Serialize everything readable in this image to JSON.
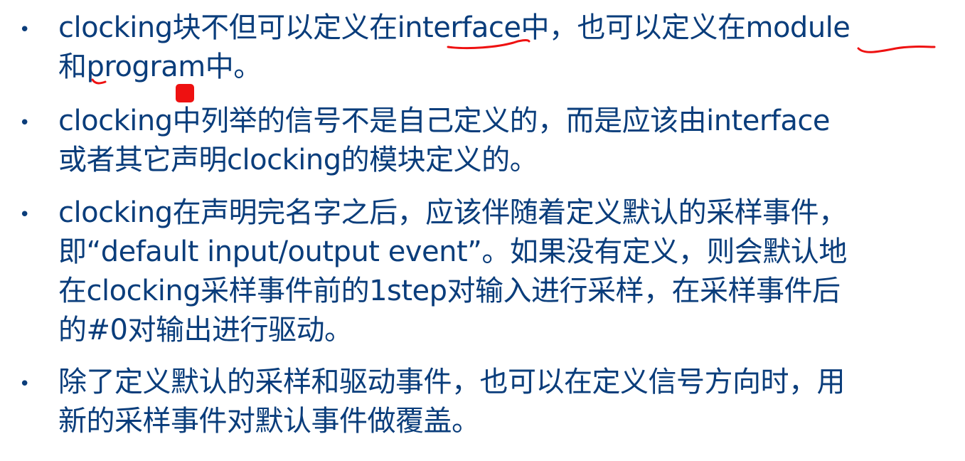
{
  "slide": {
    "bullets": [
      {
        "symbol": "•",
        "text": "clocking块不但可以定义在interface中，也可以定义在module\n和program中。"
      },
      {
        "symbol": "•",
        "text": "clocking中列举的信号不是自己定义的，而是应该由interface\n或者其它声明clocking的模块定义的。"
      },
      {
        "symbol": "•",
        "text": "clocking在声明完名字之后，应该伴随着定义默认的采样事件，\n即“default input/output event”。如果没有定义，则会默认地\n在clocking采样事件前的1step对输入进行采样，在采样事件后\n的#0对输出进行驱动。"
      },
      {
        "symbol": "•",
        "text": "除了定义默认的采样和驱动事件，也可以在定义信号方向时，用\n新的采样事件对默认事件做覆盖。"
      }
    ]
  },
  "colors": {
    "text": "#0a3d7b",
    "annotation": "#ee1111",
    "background": "#ffffff"
  }
}
